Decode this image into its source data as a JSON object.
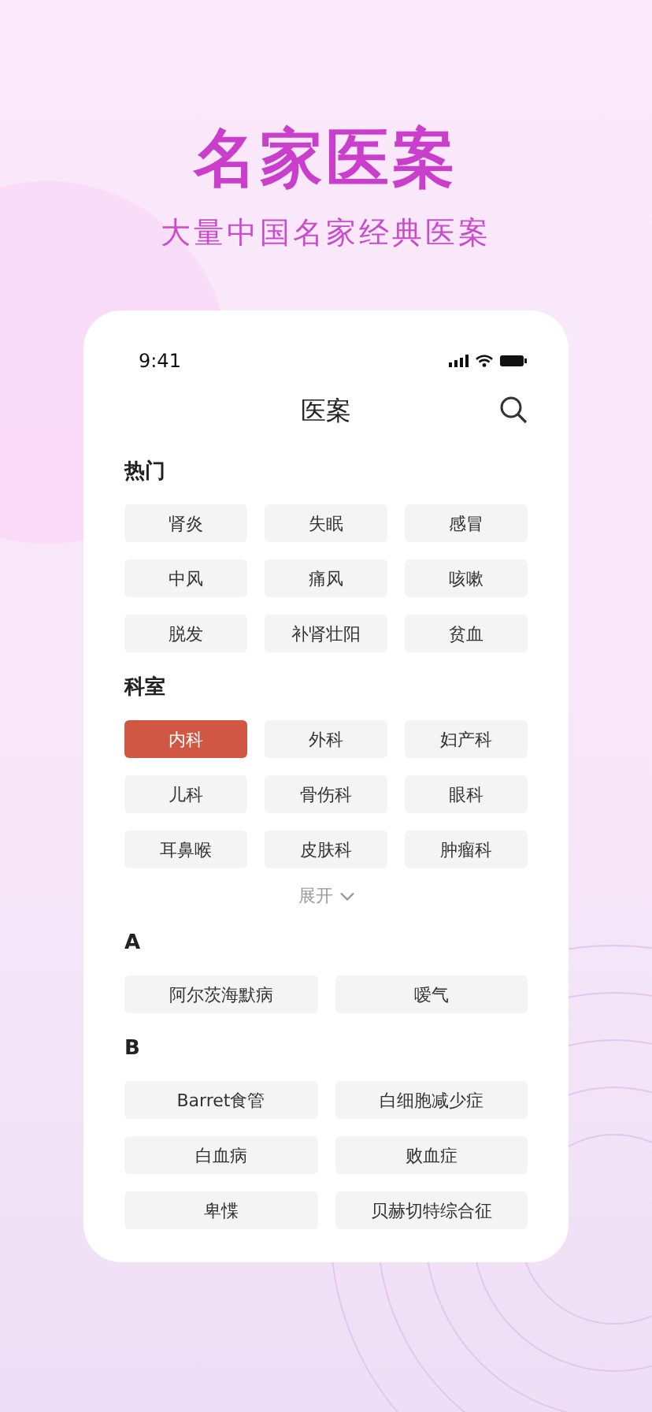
{
  "headline": "名家医案",
  "subtitle": "大量中国名家经典医案",
  "phone": {
    "status_time": "9:41",
    "title": "医案",
    "sections": [
      {
        "title": "热门",
        "kind": "grid3",
        "items": [
          {
            "label": "肾炎",
            "selected": false
          },
          {
            "label": "失眠",
            "selected": false
          },
          {
            "label": "感冒",
            "selected": false
          },
          {
            "label": "中风",
            "selected": false
          },
          {
            "label": "痛风",
            "selected": false
          },
          {
            "label": "咳嗽",
            "selected": false
          },
          {
            "label": "脱发",
            "selected": false
          },
          {
            "label": "补肾壮阳",
            "selected": false
          },
          {
            "label": "贫血",
            "selected": false
          }
        ]
      },
      {
        "title": "科室",
        "kind": "grid3",
        "expand": "展开",
        "items": [
          {
            "label": "内科",
            "selected": true
          },
          {
            "label": "外科",
            "selected": false
          },
          {
            "label": "妇产科",
            "selected": false
          },
          {
            "label": "儿科",
            "selected": false
          },
          {
            "label": "骨伤科",
            "selected": false
          },
          {
            "label": "眼科",
            "selected": false
          },
          {
            "label": "耳鼻喉",
            "selected": false
          },
          {
            "label": "皮肤科",
            "selected": false
          },
          {
            "label": "肿瘤科",
            "selected": false
          }
        ]
      },
      {
        "title": "A",
        "kind": "grid2",
        "items": [
          {
            "label": "阿尔茨海默病",
            "selected": false
          },
          {
            "label": "嗳气",
            "selected": false
          }
        ]
      },
      {
        "title": "B",
        "kind": "grid2",
        "items": [
          {
            "label": "Barret食管",
            "selected": false
          },
          {
            "label": "白细胞减少症",
            "selected": false
          },
          {
            "label": "白血病",
            "selected": false
          },
          {
            "label": "败血症",
            "selected": false
          },
          {
            "label": "卑惵",
            "selected": false
          },
          {
            "label": "贝赫切特综合征",
            "selected": false
          }
        ]
      }
    ]
  }
}
